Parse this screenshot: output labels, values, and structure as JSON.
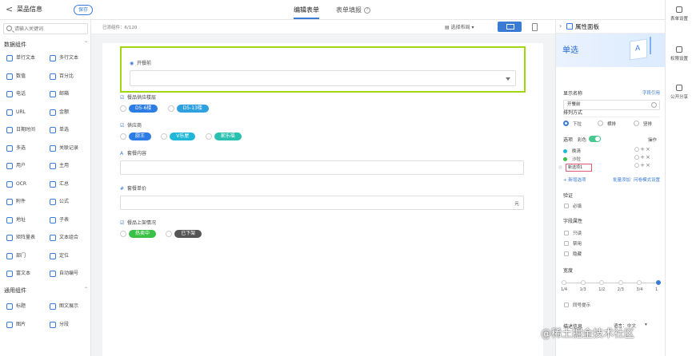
{
  "header": {
    "back": "<",
    "title": "菜品信息",
    "save": "保存",
    "tabs": [
      {
        "label": "编辑表单"
      },
      {
        "label": "表单填报"
      }
    ]
  },
  "sidebar": {
    "search_placeholder": "请输入关键词",
    "sections": [
      {
        "label": "数据组件"
      },
      {
        "label": "通用组件"
      }
    ],
    "components": [
      "单行文本",
      "多行文本",
      "数值",
      "百分比",
      "电话",
      "邮箱",
      "URL",
      "金额",
      "日期时间",
      "单选",
      "多选",
      "关联记录",
      "用户",
      "主用",
      "OCR",
      "汇总",
      "附件",
      "公式",
      "地址",
      "子表",
      "矩阵量表",
      "文本组合",
      "部门",
      "定位",
      "富文本",
      "自动编号"
    ],
    "general_components": [
      "标题",
      "图文展示",
      "图片",
      "分段"
    ]
  },
  "toolbar": {
    "count": "已添组件：6/120",
    "layout": "选择布局"
  },
  "form": {
    "selected_field_label": "开餐前",
    "fields": [
      {
        "label": "餐品供应楼层",
        "options": [
          {
            "text": "D5-6楼",
            "color": "#2d7be5"
          },
          {
            "text": "D5-13楼",
            "color": "#2fa0e0"
          }
        ]
      },
      {
        "label": "供应商",
        "options": [
          {
            "text": "厨王",
            "color": "#2d7be5"
          },
          {
            "text": "V乐屋",
            "color": "#20b8d8"
          },
          {
            "text": "家乐福",
            "color": "#2ac0b0"
          }
        ]
      },
      {
        "label": "套餐内容"
      },
      {
        "label": "套餐单价",
        "unit": "元"
      },
      {
        "label": "餐品上架情况",
        "options": [
          {
            "text": "热卖中",
            "color": "#3bc047"
          },
          {
            "text": "已下架",
            "color": "#555555"
          }
        ]
      }
    ]
  },
  "panel": {
    "title": "属性面板",
    "type": "单选",
    "display_name_label": "显示名称",
    "field_reference": "字段引用",
    "display_name_value": "开餐前",
    "layout_label": "排列方式",
    "layout_options": [
      "下拉",
      "横排",
      "竖排"
    ],
    "options_label": "选项",
    "color_label": "彩色",
    "ops_label": "操作",
    "options": [
      {
        "text": "晚清",
        "color": "#20b8d8"
      },
      {
        "text": "沙拉",
        "color": "#3bc047"
      },
      {
        "text": "新选项1",
        "color": "#e6e6e6"
      }
    ],
    "add_option": "新增选项",
    "batch_add": "批量添加",
    "set_color": "问卷模式设置",
    "validation_label": "验证",
    "required": "必填",
    "field_attr_label": "字段属性",
    "attrs": [
      "只读",
      "禁用",
      "隐藏"
    ],
    "width_label": "宽度",
    "width_ticks": [
      "1/4",
      "1/3",
      "1/2",
      "2/3",
      "3/4",
      "1"
    ],
    "width_value": 1,
    "same_row_hint": "同号提示",
    "description_label": "描述信息",
    "language_label": "语言：",
    "language_value": "中文"
  },
  "right_bar": {
    "items": [
      "表单设置",
      "权限设置",
      "公开分享"
    ]
  },
  "watermark": "@稀土掘金技术社区"
}
